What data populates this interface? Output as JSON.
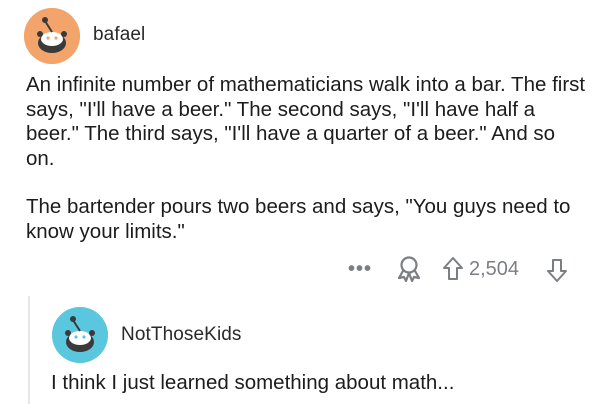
{
  "post": {
    "username": "bafael",
    "paragraph1": "An infinite number of mathematicians walk into a bar. The first says, \"I'll have a beer.\" The second says, \"I'll have half a beer.\" The third says, \"I'll have a quarter of a beer.\" And so on.",
    "paragraph2": "The bartender pours two beers and says, \"You guys need to know your limits.\"",
    "more_label": "•••",
    "score": "2,504"
  },
  "reply": {
    "username": "NotThoseKids",
    "text": "I think I just learned something about math..."
  },
  "colors": {
    "avatar1": "#f3a46b",
    "avatar2": "#5bc7de",
    "meta": "#7b7f83"
  },
  "icons": [
    "avatar-icon",
    "more-icon",
    "award-icon",
    "upvote-icon",
    "downvote-icon"
  ]
}
